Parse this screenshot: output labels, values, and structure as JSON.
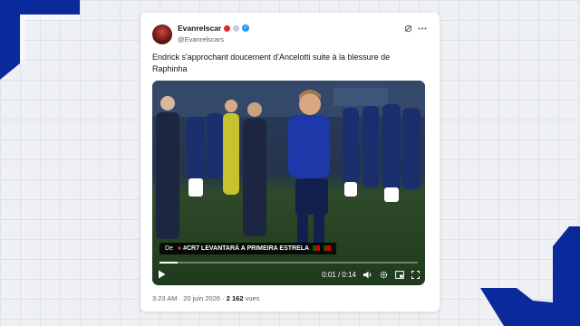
{
  "tweet": {
    "display_name": "Evanrelscar",
    "handle": "@Evanrelscars",
    "text": "Endrick s'approchant doucement d'Ancelotti suite à la blessure de Raphinha",
    "timestamp": "3:23 AM · 20 juin 2026 · ",
    "views_count": "2 162",
    "views_label": " vues"
  },
  "video": {
    "caption_prefix": "De",
    "caption_text": "#CR7 LEVANTARÁ A PRIMEIRA ESTRELA",
    "current_time": "0:01",
    "separator": " / ",
    "duration": "0:14",
    "progress": 0.07
  },
  "icons": {
    "badge_red": "red-circle-badge",
    "badge_gray": "gray-circle-badge",
    "verified": "verified-check-icon",
    "grok": "grok-icon",
    "more": "more-options-icon",
    "play": "play-icon",
    "volume": "volume-icon",
    "settings": "settings-gear-icon",
    "pip": "picture-in-picture-icon",
    "fullscreen": "fullscreen-icon"
  },
  "colors": {
    "accent_blue": "#1d9bf0",
    "background_navy": "#0a2a9c",
    "badge_red": "#e0242a",
    "badge_gray": "#c7ccd3"
  }
}
